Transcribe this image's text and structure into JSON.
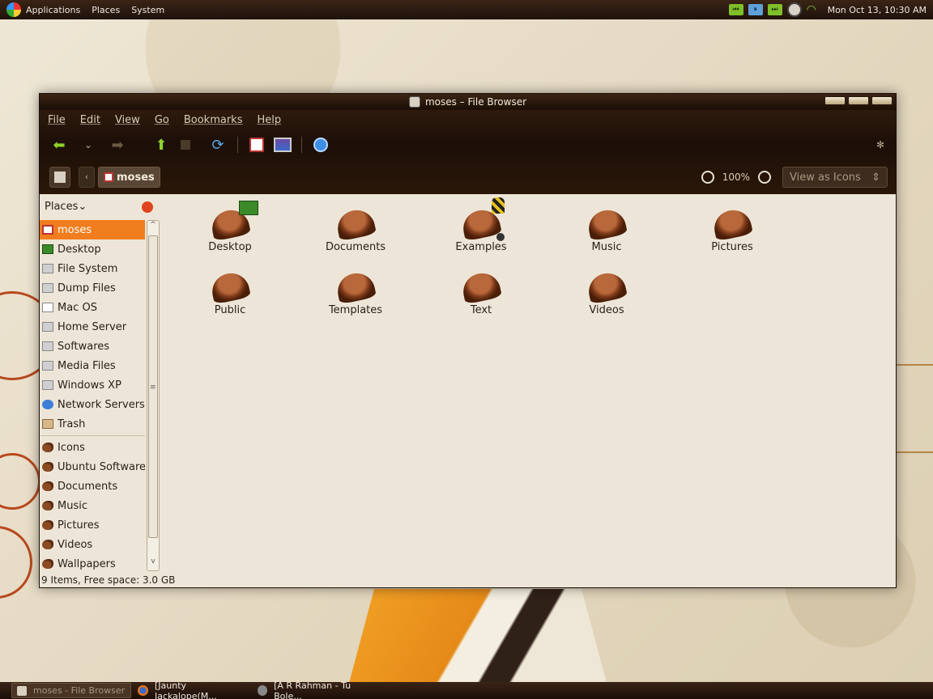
{
  "top_panel": {
    "menus": [
      "Applications",
      "Places",
      "System"
    ],
    "clock": "Mon Oct 13, 10:30 AM"
  },
  "window": {
    "title": "moses – File Browser",
    "menubar": [
      "File",
      "Edit",
      "View",
      "Go",
      "Bookmarks",
      "Help"
    ],
    "location": {
      "breadcrumb": "moses",
      "zoom": "100%",
      "view_mode": "View as Icons"
    },
    "sidebar": {
      "header": "Places",
      "places": [
        {
          "label": "moses",
          "icon": "home-icon",
          "selected": true
        },
        {
          "label": "Desktop",
          "icon": "desktop-icon"
        },
        {
          "label": "File System",
          "icon": "drive-icon"
        },
        {
          "label": "Dump Files",
          "icon": "drive-icon"
        },
        {
          "label": "Mac OS",
          "icon": "drive-icon"
        },
        {
          "label": "Home Server",
          "icon": "drive-icon"
        },
        {
          "label": "Softwares",
          "icon": "drive-icon"
        },
        {
          "label": "Media Files",
          "icon": "drive-icon"
        },
        {
          "label": "Windows XP",
          "icon": "drive-icon"
        },
        {
          "label": "Network Servers",
          "icon": "network-icon"
        },
        {
          "label": "Trash",
          "icon": "trash-icon"
        }
      ],
      "bookmarks": [
        {
          "label": "Icons",
          "icon": "folder-icon"
        },
        {
          "label": "Ubuntu Softwares",
          "icon": "folder-icon"
        },
        {
          "label": "Documents",
          "icon": "folder-icon"
        },
        {
          "label": "Music",
          "icon": "folder-icon"
        },
        {
          "label": "Pictures",
          "icon": "folder-icon"
        },
        {
          "label": "Videos",
          "icon": "folder-icon"
        },
        {
          "label": "Wallpapers",
          "icon": "folder-icon"
        }
      ]
    },
    "files": [
      {
        "label": "Desktop"
      },
      {
        "label": "Documents"
      },
      {
        "label": "Examples"
      },
      {
        "label": "Music"
      },
      {
        "label": "Pictures"
      },
      {
        "label": "Public"
      },
      {
        "label": "Templates"
      },
      {
        "label": "Text"
      },
      {
        "label": "Videos"
      }
    ],
    "status": "9 Items, Free space: 3.0 GB"
  },
  "taskbar": {
    "items": [
      "moses - File Browser",
      "[Jaunty Jackalope(M...",
      "[A R Rahman - Tu Bole..."
    ]
  },
  "colors": {
    "accent": "#f07d1e",
    "chrome_dark": "#1c0f07",
    "content_bg": "#ede6d8"
  }
}
